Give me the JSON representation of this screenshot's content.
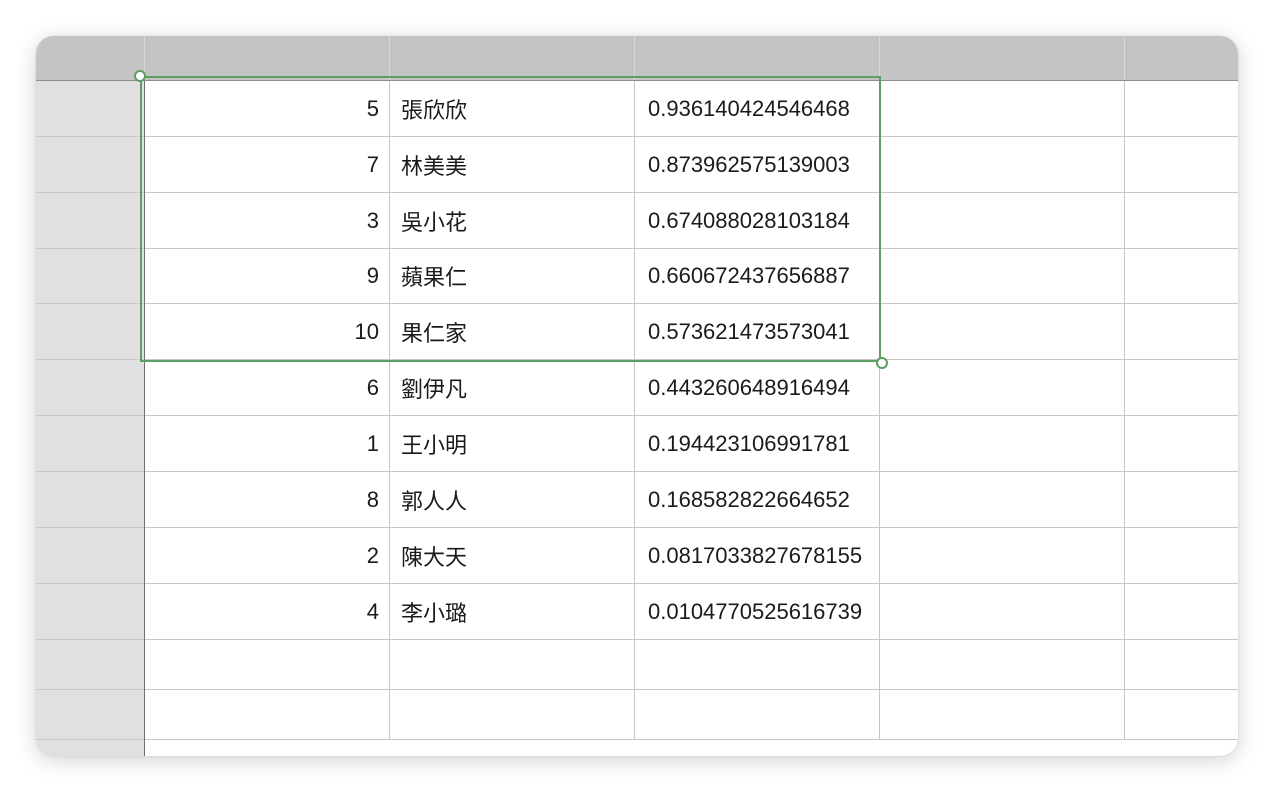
{
  "sheet": {
    "rows": [
      {
        "id": "5",
        "name": "張欣欣",
        "score": "0.936140424546468"
      },
      {
        "id": "7",
        "name": "林美美",
        "score": "0.873962575139003"
      },
      {
        "id": "3",
        "name": "吳小花",
        "score": "0.674088028103184"
      },
      {
        "id": "9",
        "name": "蘋果仁",
        "score": "0.660672437656887"
      },
      {
        "id": "10",
        "name": "果仁家",
        "score": "0.573621473573041"
      },
      {
        "id": "6",
        "name": "劉伊凡",
        "score": "0.443260648916494"
      },
      {
        "id": "1",
        "name": "王小明",
        "score": "0.194423106991781"
      },
      {
        "id": "8",
        "name": "郭人人",
        "score": "0.168582822664652"
      },
      {
        "id": "2",
        "name": "陳大天",
        "score": "0.0817033827678155"
      },
      {
        "id": "4",
        "name": "李小璐",
        "score": "0.0104770525616739"
      },
      {
        "id": "",
        "name": "",
        "score": ""
      },
      {
        "id": "",
        "name": "",
        "score": ""
      }
    ],
    "selection": {
      "range_start_row": 1,
      "range_end_row": 5,
      "range_start_col": 1,
      "range_end_col": 3
    },
    "colors": {
      "header_bg": "#c3c4c3",
      "row_header_bg": "#e0e0e0",
      "selection_border": "#5c9e63",
      "gridline": "#c6c6c6"
    }
  }
}
